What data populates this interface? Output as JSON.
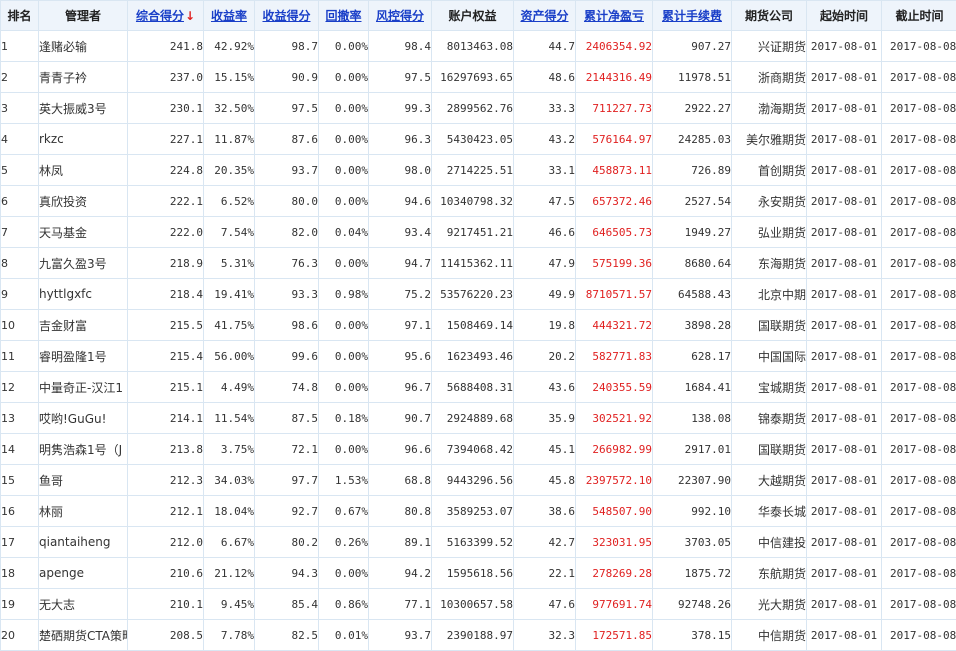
{
  "columns": [
    {
      "key": "rank",
      "label": "排名",
      "sortable": false
    },
    {
      "key": "manager",
      "label": "管理者",
      "sortable": false
    },
    {
      "key": "score",
      "label": "综合得分",
      "sortable": true,
      "sorted_desc": true
    },
    {
      "key": "return_rate",
      "label": "收益率",
      "sortable": true
    },
    {
      "key": "return_score",
      "label": "收益得分",
      "sortable": true
    },
    {
      "key": "drawdown",
      "label": "回撤率",
      "sortable": true
    },
    {
      "key": "risk_score",
      "label": "风控得分",
      "sortable": true
    },
    {
      "key": "equity",
      "label": "账户权益",
      "sortable": false
    },
    {
      "key": "asset_score",
      "label": "资产得分",
      "sortable": true
    },
    {
      "key": "net_pnl",
      "label": "累计净盈亏",
      "sortable": true
    },
    {
      "key": "fees",
      "label": "累计手续费",
      "sortable": true
    },
    {
      "key": "company",
      "label": "期货公司",
      "sortable": false
    },
    {
      "key": "start",
      "label": "起始时间",
      "sortable": false
    },
    {
      "key": "end",
      "label": "截止时间",
      "sortable": false
    }
  ],
  "sort_arrow": "↓",
  "colors": {
    "link": "#1a3fc8",
    "pnl": "#e02020",
    "header_bg": "#eef4fb",
    "grid": "#d9e6f2"
  },
  "rows": [
    {
      "rank": "1",
      "manager": "逢赌必输",
      "score": "241.8",
      "return_rate": "42.92%",
      "return_score": "98.7",
      "drawdown": "0.00%",
      "risk_score": "98.4",
      "equity": "8013463.08",
      "asset_score": "44.7",
      "net_pnl": "2406354.92",
      "fees": "907.27",
      "company": "兴证期货",
      "start": "2017-08-01",
      "end": "2017-08-08"
    },
    {
      "rank": "2",
      "manager": "青青子衿",
      "score": "237.0",
      "return_rate": "15.15%",
      "return_score": "90.9",
      "drawdown": "0.00%",
      "risk_score": "97.5",
      "equity": "16297693.65",
      "asset_score": "48.6",
      "net_pnl": "2144316.49",
      "fees": "11978.51",
      "company": "浙商期货",
      "start": "2017-08-01",
      "end": "2017-08-08"
    },
    {
      "rank": "3",
      "manager": "英大振威3号",
      "score": "230.1",
      "return_rate": "32.50%",
      "return_score": "97.5",
      "drawdown": "0.00%",
      "risk_score": "99.3",
      "equity": "2899562.76",
      "asset_score": "33.3",
      "net_pnl": "711227.73",
      "fees": "2922.27",
      "company": "渤海期货",
      "start": "2017-08-01",
      "end": "2017-08-08"
    },
    {
      "rank": "4",
      "manager": "rkzc",
      "score": "227.1",
      "return_rate": "11.87%",
      "return_score": "87.6",
      "drawdown": "0.00%",
      "risk_score": "96.3",
      "equity": "5430423.05",
      "asset_score": "43.2",
      "net_pnl": "576164.97",
      "fees": "24285.03",
      "company": "美尔雅期货",
      "start": "2017-08-01",
      "end": "2017-08-08"
    },
    {
      "rank": "5",
      "manager": "林凤",
      "score": "224.8",
      "return_rate": "20.35%",
      "return_score": "93.7",
      "drawdown": "0.00%",
      "risk_score": "98.0",
      "equity": "2714225.51",
      "asset_score": "33.1",
      "net_pnl": "458873.11",
      "fees": "726.89",
      "company": "首创期货",
      "start": "2017-08-01",
      "end": "2017-08-08"
    },
    {
      "rank": "6",
      "manager": "真欣投资",
      "score": "222.1",
      "return_rate": "6.52%",
      "return_score": "80.0",
      "drawdown": "0.00%",
      "risk_score": "94.6",
      "equity": "10340798.32",
      "asset_score": "47.5",
      "net_pnl": "657372.46",
      "fees": "2527.54",
      "company": "永安期货",
      "start": "2017-08-01",
      "end": "2017-08-08"
    },
    {
      "rank": "7",
      "manager": "天马基金",
      "score": "222.0",
      "return_rate": "7.54%",
      "return_score": "82.0",
      "drawdown": "0.04%",
      "risk_score": "93.4",
      "equity": "9217451.21",
      "asset_score": "46.6",
      "net_pnl": "646505.73",
      "fees": "1949.27",
      "company": "弘业期货",
      "start": "2017-08-01",
      "end": "2017-08-08"
    },
    {
      "rank": "8",
      "manager": "九富久盈3号",
      "score": "218.9",
      "return_rate": "5.31%",
      "return_score": "76.3",
      "drawdown": "0.00%",
      "risk_score": "94.7",
      "equity": "11415362.11",
      "asset_score": "47.9",
      "net_pnl": "575199.36",
      "fees": "8680.64",
      "company": "东海期货",
      "start": "2017-08-01",
      "end": "2017-08-08"
    },
    {
      "rank": "9",
      "manager": "hyttlgxfc",
      "score": "218.4",
      "return_rate": "19.41%",
      "return_score": "93.3",
      "drawdown": "0.98%",
      "risk_score": "75.2",
      "equity": "53576220.23",
      "asset_score": "49.9",
      "net_pnl": "8710571.57",
      "fees": "64588.43",
      "company": "北京中期",
      "start": "2017-08-01",
      "end": "2017-08-08"
    },
    {
      "rank": "10",
      "manager": "吉金财富",
      "score": "215.5",
      "return_rate": "41.75%",
      "return_score": "98.6",
      "drawdown": "0.00%",
      "risk_score": "97.1",
      "equity": "1508469.14",
      "asset_score": "19.8",
      "net_pnl": "444321.72",
      "fees": "3898.28",
      "company": "国联期货",
      "start": "2017-08-01",
      "end": "2017-08-08"
    },
    {
      "rank": "11",
      "manager": "睿明盈隆1号",
      "score": "215.4",
      "return_rate": "56.00%",
      "return_score": "99.6",
      "drawdown": "0.00%",
      "risk_score": "95.6",
      "equity": "1623493.46",
      "asset_score": "20.2",
      "net_pnl": "582771.83",
      "fees": "628.17",
      "company": "中国国际",
      "start": "2017-08-01",
      "end": "2017-08-08"
    },
    {
      "rank": "12",
      "manager": "中量奇正-汉江1",
      "score": "215.1",
      "return_rate": "4.49%",
      "return_score": "74.8",
      "drawdown": "0.00%",
      "risk_score": "96.7",
      "equity": "5688408.31",
      "asset_score": "43.6",
      "net_pnl": "240355.59",
      "fees": "1684.41",
      "company": "宝城期货",
      "start": "2017-08-01",
      "end": "2017-08-08"
    },
    {
      "rank": "13",
      "manager": "哎哟!GuGu!",
      "score": "214.1",
      "return_rate": "11.54%",
      "return_score": "87.5",
      "drawdown": "0.18%",
      "risk_score": "90.7",
      "equity": "2924889.68",
      "asset_score": "35.9",
      "net_pnl": "302521.92",
      "fees": "138.08",
      "company": "锦泰期货",
      "start": "2017-08-01",
      "end": "2017-08-08"
    },
    {
      "rank": "14",
      "manager": "明隽浩森1号（J",
      "score": "213.8",
      "return_rate": "3.75%",
      "return_score": "72.1",
      "drawdown": "0.00%",
      "risk_score": "96.6",
      "equity": "7394068.42",
      "asset_score": "45.1",
      "net_pnl": "266982.99",
      "fees": "2917.01",
      "company": "国联期货",
      "start": "2017-08-01",
      "end": "2017-08-08"
    },
    {
      "rank": "15",
      "manager": "鱼哥",
      "score": "212.3",
      "return_rate": "34.03%",
      "return_score": "97.7",
      "drawdown": "1.53%",
      "risk_score": "68.8",
      "equity": "9443296.56",
      "asset_score": "45.8",
      "net_pnl": "2397572.10",
      "fees": "22307.90",
      "company": "大越期货",
      "start": "2017-08-01",
      "end": "2017-08-08"
    },
    {
      "rank": "16",
      "manager": "林丽",
      "score": "212.1",
      "return_rate": "18.04%",
      "return_score": "92.7",
      "drawdown": "0.67%",
      "risk_score": "80.8",
      "equity": "3589253.07",
      "asset_score": "38.6",
      "net_pnl": "548507.90",
      "fees": "992.10",
      "company": "华泰长城",
      "start": "2017-08-01",
      "end": "2017-08-08"
    },
    {
      "rank": "17",
      "manager": "qiantaiheng",
      "score": "212.0",
      "return_rate": "6.67%",
      "return_score": "80.2",
      "drawdown": "0.26%",
      "risk_score": "89.1",
      "equity": "5163399.52",
      "asset_score": "42.7",
      "net_pnl": "323031.95",
      "fees": "3703.05",
      "company": "中信建投",
      "start": "2017-08-01",
      "end": "2017-08-08"
    },
    {
      "rank": "18",
      "manager": "apenge",
      "score": "210.6",
      "return_rate": "21.12%",
      "return_score": "94.3",
      "drawdown": "0.00%",
      "risk_score": "94.2",
      "equity": "1595618.56",
      "asset_score": "22.1",
      "net_pnl": "278269.28",
      "fees": "1875.72",
      "company": "东航期货",
      "start": "2017-08-01",
      "end": "2017-08-08"
    },
    {
      "rank": "19",
      "manager": "无大志",
      "score": "210.1",
      "return_rate": "9.45%",
      "return_score": "85.4",
      "drawdown": "0.86%",
      "risk_score": "77.1",
      "equity": "10300657.58",
      "asset_score": "47.6",
      "net_pnl": "977691.74",
      "fees": "92748.26",
      "company": "光大期货",
      "start": "2017-08-01",
      "end": "2017-08-08"
    },
    {
      "rank": "20",
      "manager": "楚硒期货CTA策略",
      "score": "208.5",
      "return_rate": "7.78%",
      "return_score": "82.5",
      "drawdown": "0.01%",
      "risk_score": "93.7",
      "equity": "2390188.97",
      "asset_score": "32.3",
      "net_pnl": "172571.85",
      "fees": "378.15",
      "company": "中信期货",
      "start": "2017-08-01",
      "end": "2017-08-08"
    }
  ]
}
